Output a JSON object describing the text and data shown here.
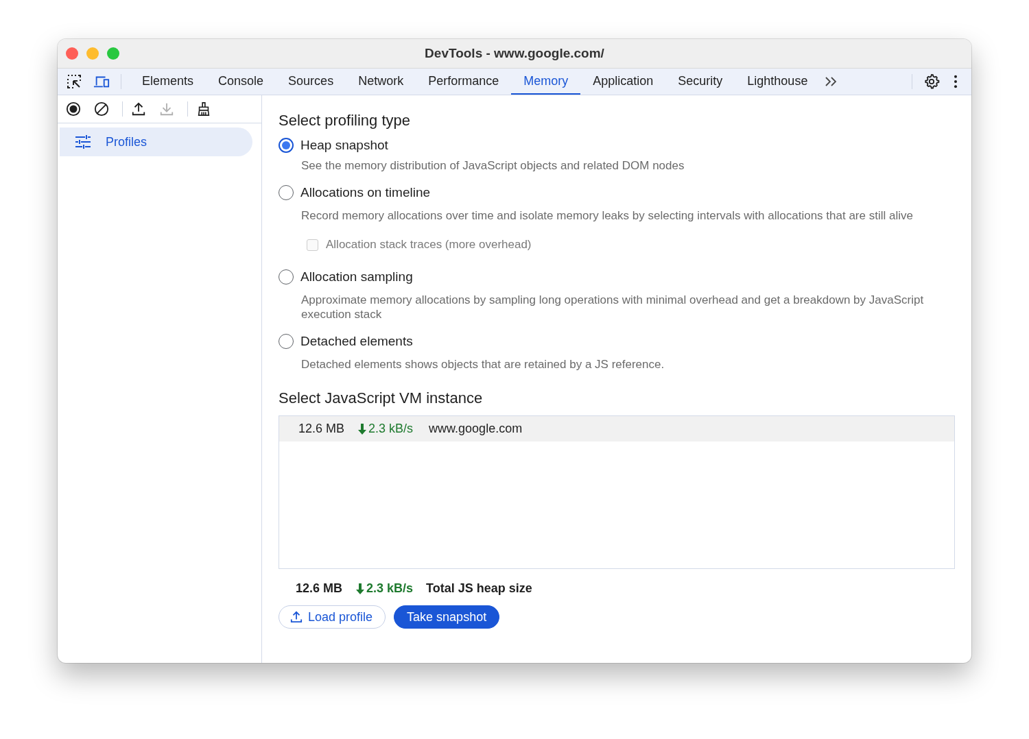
{
  "window": {
    "title": "DevTools - www.google.com/"
  },
  "tabs": [
    {
      "label": "Elements",
      "selected": false
    },
    {
      "label": "Console",
      "selected": false
    },
    {
      "label": "Sources",
      "selected": false
    },
    {
      "label": "Network",
      "selected": false
    },
    {
      "label": "Performance",
      "selected": false
    },
    {
      "label": "Memory",
      "selected": true
    },
    {
      "label": "Application",
      "selected": false
    },
    {
      "label": "Security",
      "selected": false
    },
    {
      "label": "Lighthouse",
      "selected": false
    }
  ],
  "sidebar_toolbar": [
    {
      "kind": "record",
      "disabled": false
    },
    {
      "kind": "clear",
      "disabled": false
    },
    {
      "kind": "upload",
      "disabled": false
    },
    {
      "kind": "download",
      "disabled": true
    },
    {
      "kind": "broom",
      "disabled": false
    }
  ],
  "sidebar": {
    "items": [
      {
        "label": "Profiles",
        "selected": true
      }
    ]
  },
  "profiling_heading": "Select profiling type",
  "options": [
    {
      "label": "Heap snapshot",
      "selected": true,
      "description": "See the memory distribution of JavaScript objects and related DOM nodes"
    },
    {
      "label": "Allocations on timeline",
      "selected": false,
      "description": "Record memory allocations over time and isolate memory leaks by selecting intervals with allocations that are still alive",
      "checkbox": {
        "label": "Allocation stack traces (more overhead)",
        "checked": false,
        "disabled": true
      }
    },
    {
      "label": "Allocation sampling",
      "selected": false,
      "description": "Approximate memory allocations by sampling long operations with minimal overhead and get a breakdown by JavaScript execution stack"
    },
    {
      "label": "Detached elements",
      "selected": false,
      "description": "Detached elements shows objects that are retained by a JS reference."
    }
  ],
  "vm_heading": "Select JavaScript VM instance",
  "vm_instances": [
    {
      "size": "12.6 MB",
      "rate": "2.3 kB/s",
      "name": "www.google.com",
      "selected": true
    }
  ],
  "summary": {
    "size": "12.6 MB",
    "rate": "2.3 kB/s",
    "label": "Total JS heap size"
  },
  "buttons": [
    {
      "label": "Load profile",
      "kind": "secondary"
    },
    {
      "label": "Take snapshot",
      "kind": "primary"
    }
  ]
}
